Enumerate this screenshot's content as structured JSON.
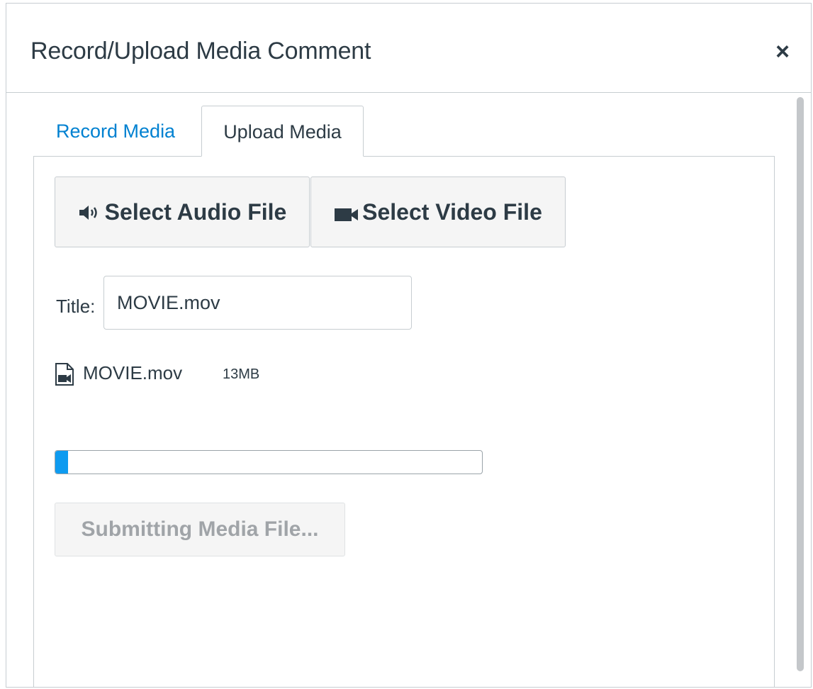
{
  "dialog": {
    "title": "Record/Upload Media Comment",
    "close_label": "×"
  },
  "tabs": [
    {
      "label": "Record Media",
      "active": false
    },
    {
      "label": "Upload Media",
      "active": true
    }
  ],
  "upload": {
    "select_audio_label": "Select Audio File",
    "select_video_label": "Select Video File",
    "audio_icon": "speaker-icon",
    "video_icon": "video-camera-icon",
    "title_label": "Title:",
    "title_value": "MOVIE.mov",
    "file": {
      "icon": "video-file-icon",
      "name": "MOVIE.mov",
      "size": "13MB"
    },
    "progress_fraction": 0.03,
    "submit_label": "Submitting Media File..."
  },
  "colors": {
    "link": "#0081d1",
    "text": "#2d3b45",
    "progress": "#0e9bf0",
    "border": "#c7cdd1",
    "disabled_text": "#a0a4a8"
  }
}
